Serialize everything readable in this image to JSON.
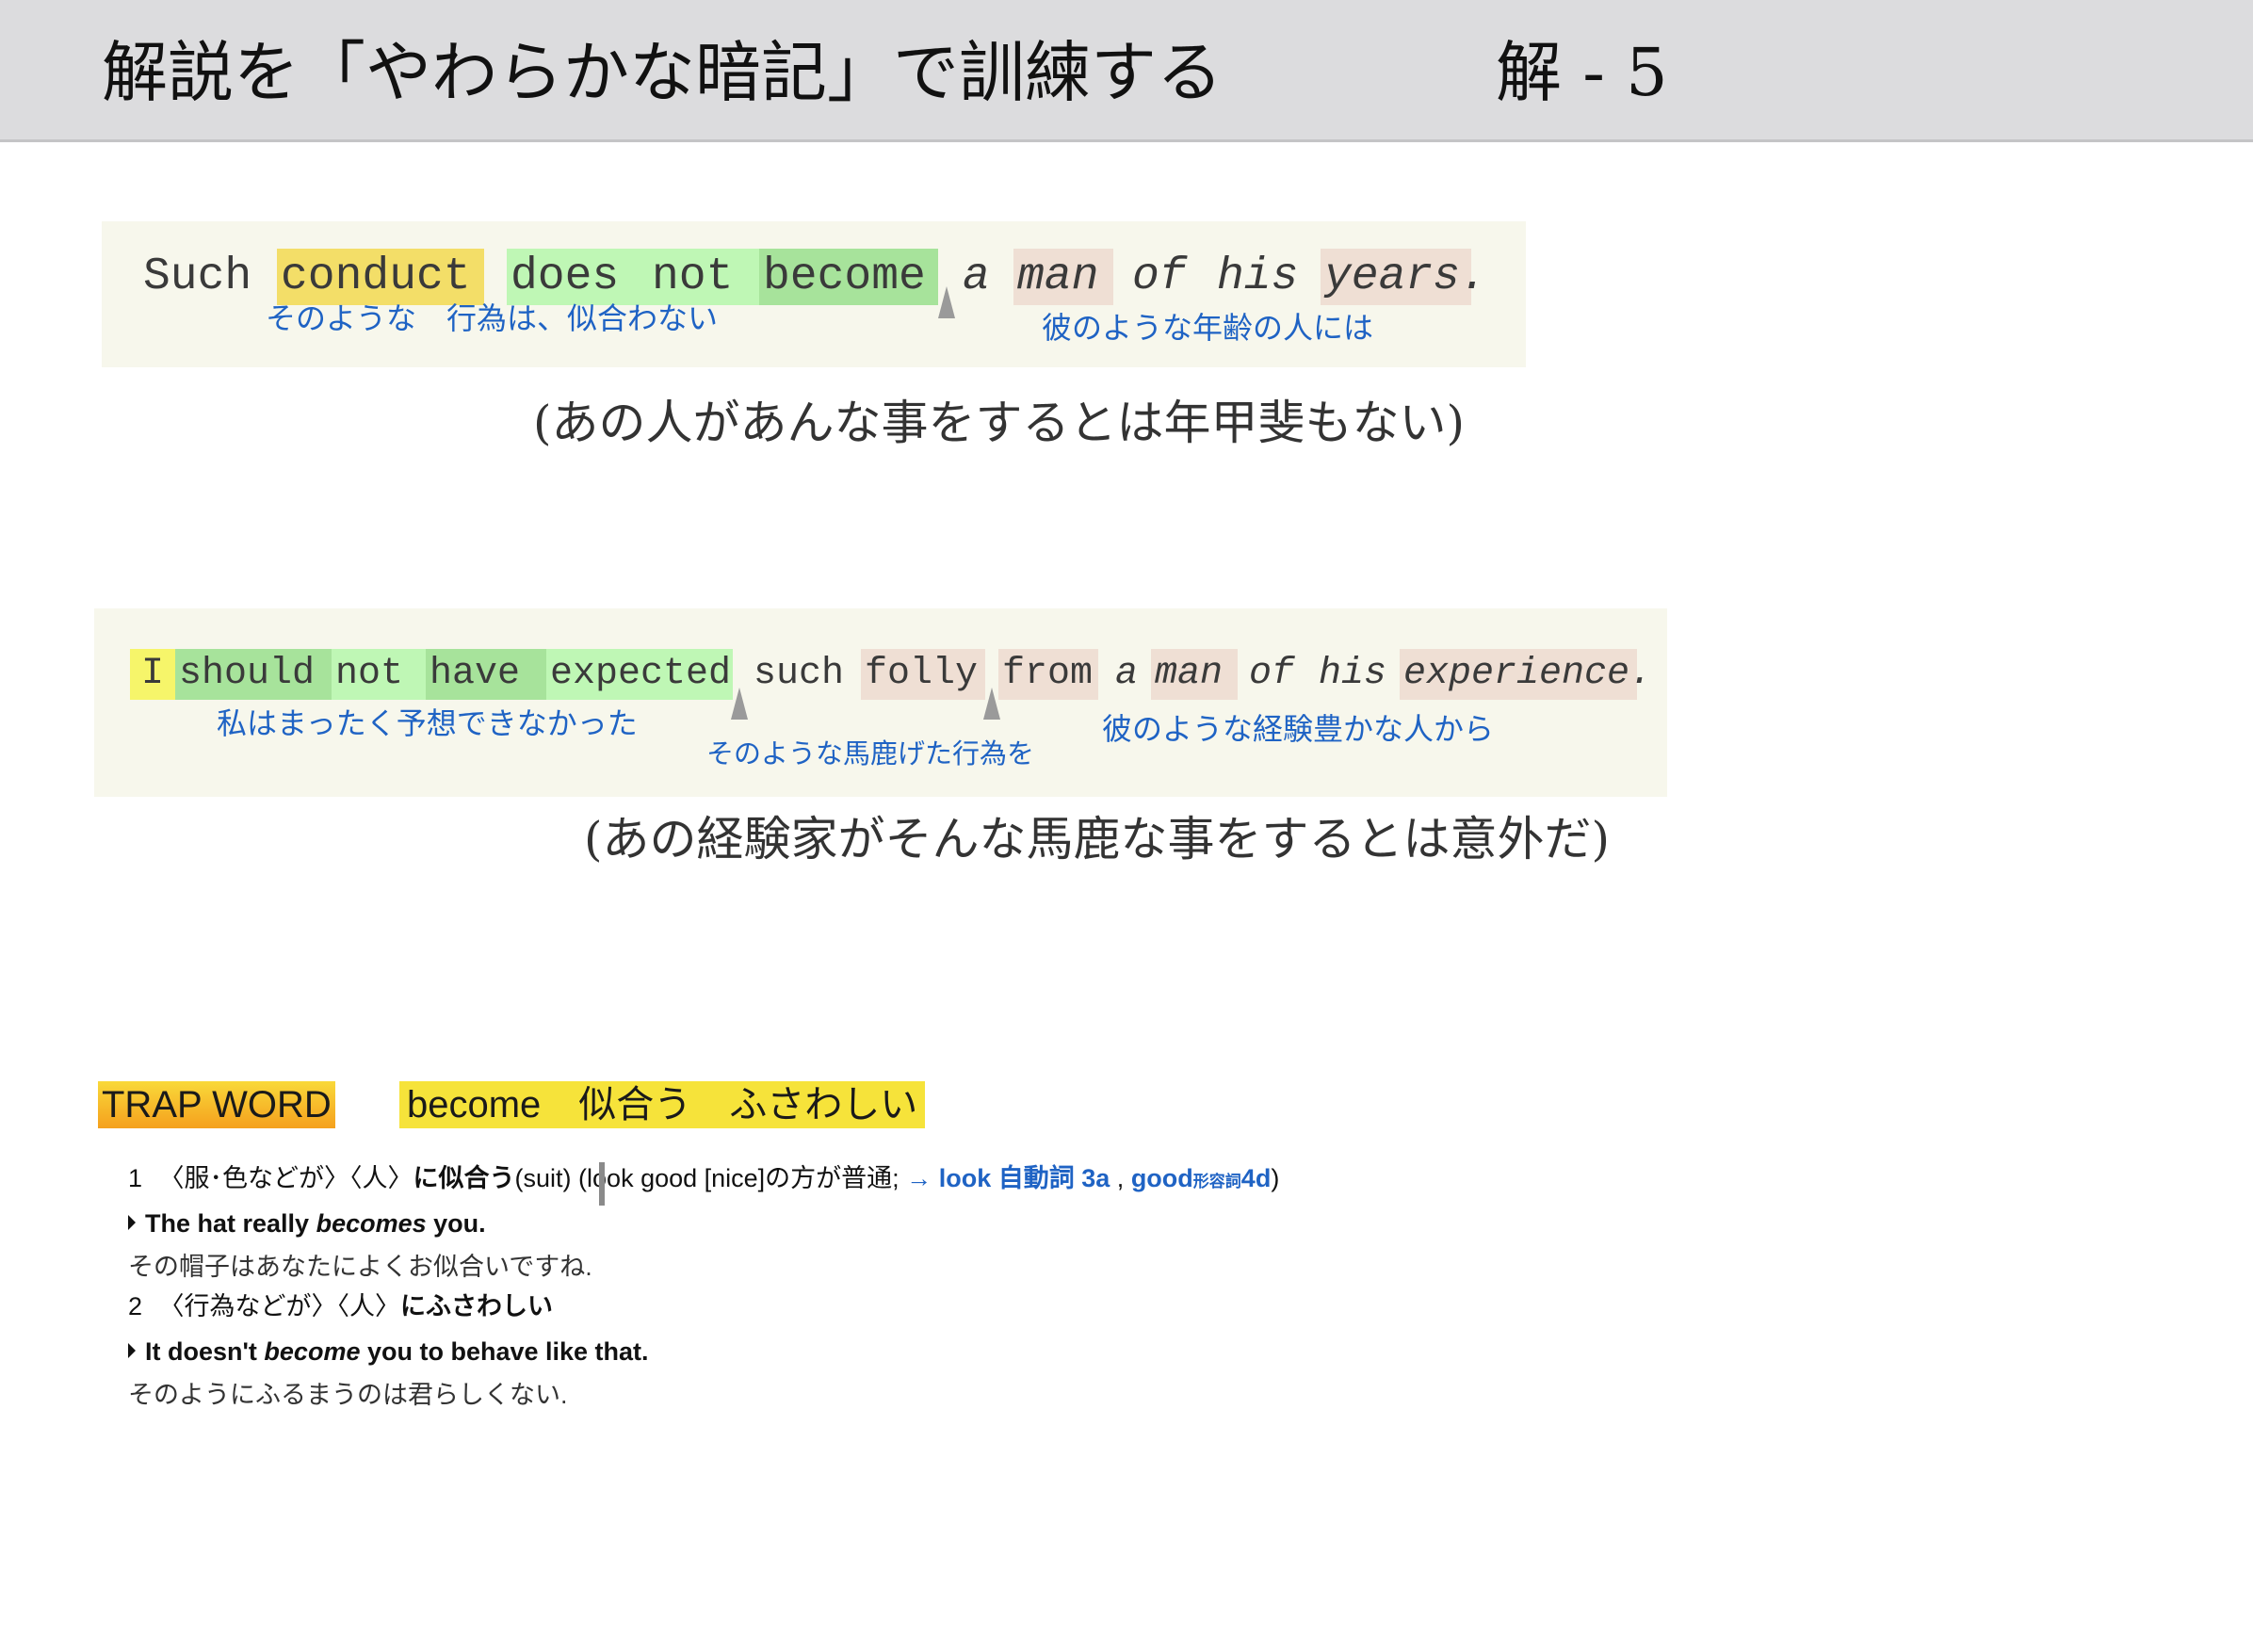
{
  "header": {
    "title": "解説を「やわらかな暗記」で訓練する",
    "page": "解 - 5"
  },
  "example1": {
    "words": [
      "Such",
      "conduct",
      "does",
      "not",
      "become",
      "a",
      "man",
      "of",
      "his",
      "years."
    ],
    "glosses": [
      "そのような",
      "行為は、似合わない",
      "彼のような年齢の人には"
    ],
    "translation": "(あの人があんな事をするとは年甲斐もない)"
  },
  "example2": {
    "words": [
      "I",
      "should",
      "not",
      "have",
      "expected",
      "such",
      "folly",
      "from",
      "a",
      "man",
      "of",
      "his",
      "experience."
    ],
    "glosses": [
      "私はまったく予想できなかった",
      "そのような馬鹿げた行為を",
      "彼のような経験豊かな人から"
    ],
    "translation": "(あの経験家がそんな馬鹿な事をするとは意外だ)"
  },
  "trap": {
    "badge": "TRAP WORD",
    "word": "become　似合う　ふさわしい"
  },
  "dictionary": {
    "sense1": {
      "num": "1",
      "context": "〈服･色などが〉〈人〉",
      "meaning": "に似合う",
      "suit": "(suit) (",
      "note": "look good [nice]の方が普通;",
      "arrow": "→",
      "link1": "look 自動詞 3a",
      "comma": ",",
      "link2_word": "good",
      "link2_pos": "形容詞",
      "link2_num": "4d",
      "close": ")"
    },
    "example1": {
      "pre": "The hat really ",
      "em": "becomes",
      "post": " you."
    },
    "translation1": "その帽子はあなたによくお似合いですね.",
    "sense2": {
      "num": "2",
      "context": "〈行為などが〉〈人〉",
      "meaning": "にふさわしい"
    },
    "example2": {
      "pre": "It doesn't ",
      "em": "become",
      "post": " you to behave like that."
    },
    "translation2": "そのようにふるまうのは君らしくない."
  }
}
